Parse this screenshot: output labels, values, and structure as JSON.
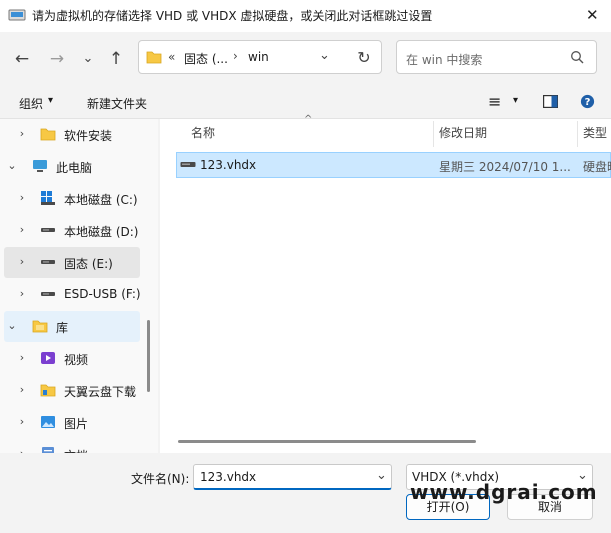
{
  "window": {
    "title": "请为虚拟机的存储选择 VHD 或 VHDX 虚拟硬盘，或关闭此对话框跳过设置",
    "close_glyph": "✕"
  },
  "nav": {
    "back_glyph": "←",
    "forward_glyph": "→",
    "recent_glyph": "⌄",
    "up_glyph": "↑",
    "refresh_glyph": "↻",
    "address": {
      "overflow": "«",
      "segment1": "固态 (...",
      "separator": "›",
      "segment2": "win",
      "dropdown_glyph": "⌄"
    },
    "search_placeholder": "在 win 中搜索",
    "search_glyph": "⌕"
  },
  "toolbar": {
    "organize": "组织",
    "organize_caret": "▾",
    "new_folder": "新建文件夹",
    "view_glyph": "≡",
    "view_caret": "▾",
    "help_glyph": "?"
  },
  "tree": [
    {
      "label": "软件安装",
      "icon": "folder-icon",
      "chevron": "›",
      "state": "normal"
    },
    {
      "label": "此电脑",
      "icon": "computer-icon",
      "chevron": "⌄",
      "state": "normal"
    },
    {
      "label": "本地磁盘 (C:)",
      "icon": "windows-drive-icon",
      "chevron": "›",
      "state": "normal"
    },
    {
      "label": "本地磁盘 (D:)",
      "icon": "drive-icon",
      "chevron": "›",
      "state": "normal"
    },
    {
      "label": "固态 (E:)",
      "icon": "drive-icon",
      "chevron": "›",
      "state": "selected"
    },
    {
      "label": "ESD-USB (F:)",
      "icon": "drive-icon",
      "chevron": "›",
      "state": "normal"
    },
    {
      "label": "库",
      "icon": "library-folder-icon",
      "chevron": "⌄",
      "state": "hover"
    },
    {
      "label": "视频",
      "icon": "video-icon",
      "chevron": "›",
      "state": "normal"
    },
    {
      "label": "天翼云盘下载",
      "icon": "cloud-folder-icon",
      "chevron": "›",
      "state": "normal"
    },
    {
      "label": "图片",
      "icon": "picture-icon",
      "chevron": "›",
      "state": "normal"
    },
    {
      "label": "文档",
      "icon": "document-icon",
      "chevron": "›",
      "state": "normal"
    }
  ],
  "columns": {
    "name": "名称",
    "modified": "修改日期",
    "type": "类型",
    "sort_glyph": "^"
  },
  "files": [
    {
      "name": "123.vhdx",
      "modified": "星期三 2024/07/10 1...",
      "type": "硬盘映"
    }
  ],
  "bottom": {
    "filename_label": "文件名(N):",
    "filename_value": "123.vhdx",
    "filetype_value": "VHDX (*.vhdx)",
    "dropdown_glyph": "⌄",
    "open_button": "打开(O)",
    "cancel_button": "取消"
  },
  "watermark": "www.dgrai.com",
  "colors": {
    "selection_bg": "#cce8ff",
    "selection_border": "#99d1ff",
    "accent": "#0067c0",
    "folder": "#f7c844"
  }
}
